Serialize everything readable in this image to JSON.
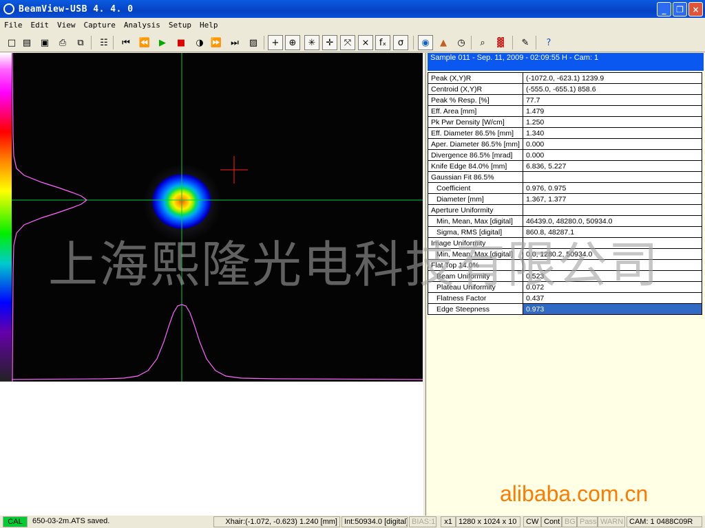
{
  "window": {
    "title": "BeamView-USB  4. 4. 0",
    "minimize": "_",
    "maximize": "❐",
    "close": "×"
  },
  "menu": [
    "File",
    "Edit",
    "View",
    "Capture",
    "Analysis",
    "Setup",
    "Help"
  ],
  "toolbar": {
    "icons": [
      "new-file-icon",
      "open-folder-icon",
      "save-icon",
      "print-icon",
      "copy-icon",
      "print-setup-icon",
      "skip-first-icon",
      "rewind-icon",
      "play-icon",
      "stop-icon",
      "capture-disk-icon",
      "fast-forward-icon",
      "skip-last-icon",
      "snapshot-icon",
      "crosshair-icon",
      "centroid-icon",
      "peak-crosshair-icon",
      "cursor-crosshair-icon",
      "profile-icon",
      "axis-profile-icon",
      "function-icon",
      "sigma-icon",
      "2d-view-icon",
      "3d-view-icon",
      "clock-icon",
      "zoom-icon",
      "palette-icon",
      "wizard-icon",
      "help-icon"
    ],
    "glyphs": {
      "new-file-icon": "□",
      "open-folder-icon": "▤",
      "save-icon": "▣",
      "print-icon": "⎙",
      "copy-icon": "⧉",
      "print-setup-icon": "☷",
      "skip-first-icon": "⏮",
      "rewind-icon": "⏪",
      "play-icon": "▶",
      "stop-icon": "■",
      "capture-disk-icon": "◑",
      "fast-forward-icon": "⏩",
      "skip-last-icon": "⏭",
      "snapshot-icon": "▨",
      "crosshair-icon": "+",
      "centroid-icon": "⊕",
      "peak-crosshair-icon": "✳",
      "cursor-crosshair-icon": "✛",
      "profile-icon": "⤧",
      "axis-profile-icon": "⨯",
      "function-icon": "fₓ",
      "sigma-icon": "σ",
      "2d-view-icon": "◉",
      "3d-view-icon": "▲",
      "clock-icon": "◷",
      "zoom-icon": "⌕",
      "palette-icon": "▓",
      "wizard-icon": "✎",
      "help-icon": "?"
    },
    "colors": {
      "play-icon": "#00aa00",
      "stop-icon": "#dd0000",
      "help-icon": "#2050c0",
      "2d-view-icon": "#1060d0",
      "3d-view-icon": "#c06020",
      "palette-icon": "#d02020"
    }
  },
  "viewer": {
    "colorbar_top": "#ffffff",
    "colorbar_bottom": "#222222",
    "crosshair_color": "#00cc44",
    "cursor_color": "#ff2020",
    "profile_color": "#ff66ff"
  },
  "results": {
    "header": "Sample  011  -  Sep. 11, 2009  -  02:09:55  H  -  Cam:  1",
    "rows": [
      {
        "label": "Peak (X,Y)R",
        "value": "(-1072.0, -623.1) 1239.9",
        "indent": false
      },
      {
        "label": "Centroid (X,Y)R",
        "value": "(-555.0, -655.1) 858.6",
        "indent": false
      },
      {
        "label": "Peak % Resp. [%]",
        "value": "77.7",
        "indent": false
      },
      {
        "label": "Eff. Area [mm]",
        "value": "1.479",
        "indent": false
      },
      {
        "label": "Pk Pwr Density [W/cm]",
        "value": "1.250",
        "indent": false
      },
      {
        "label": "Eff. Diameter 86.5% [mm]",
        "value": "1.340",
        "indent": false
      },
      {
        "label": "Aper. Diameter 86.5% [mm]",
        "value": "0.000",
        "indent": false
      },
      {
        "label": "Divergence 86.5% [mrad]",
        "value": "0.000",
        "indent": false
      },
      {
        "label": "Knife Edge 84.0% [mm]",
        "value": "6.836, 5.227",
        "indent": false
      },
      {
        "label": "Gaussian Fit 86.5%",
        "value": "",
        "indent": false
      },
      {
        "label": "Coefficient",
        "value": "0.976, 0.975",
        "indent": true
      },
      {
        "label": "Diameter [mm]",
        "value": "1.367, 1.377",
        "indent": true
      },
      {
        "label": "Aperture Uniformity",
        "value": "",
        "indent": false
      },
      {
        "label": "Min, Mean, Max [digital]",
        "value": "46439.0, 48280.0, 50934.0",
        "indent": true
      },
      {
        "label": "Sigma, RMS [digital]",
        "value": "860.8, 48287.1",
        "indent": true
      },
      {
        "label": "Image Uniformity",
        "value": "",
        "indent": false
      },
      {
        "label": "Min, Mean, Max [digital]",
        "value": "0.0, 1280.2, 50934.0",
        "indent": true
      },
      {
        "label": "Flat Top 14.0%",
        "value": "",
        "indent": false
      },
      {
        "label": "Beam Uniformity",
        "value": "0.523",
        "indent": true
      },
      {
        "label": "Plateau Uniformity",
        "value": "0.072",
        "indent": true
      },
      {
        "label": "Flatness Factor",
        "value": "0.437",
        "indent": true
      },
      {
        "label": "Edge Steepness",
        "value": "0.973",
        "indent": true,
        "selected": true
      }
    ]
  },
  "status": {
    "cal": "CAL",
    "message": "650-03-2m.ATS saved.",
    "xhair": "Xhair:(-1.072, -0.623) 1.240 [mm]",
    "intensity": "Int:50934.0 [digital]",
    "bias": "BIAS:1",
    "zoom": "x1",
    "resolution": "1280 x 1024 x 10",
    "cw": "CW",
    "cont": "Cont",
    "bg": "BG",
    "pass": "Pass",
    "warn": "WARN",
    "camera": "CAM: 1 0488C09R"
  },
  "watermark": "上海熙隆光电科技有限公司",
  "site_mark": "alibaba.com.cn"
}
